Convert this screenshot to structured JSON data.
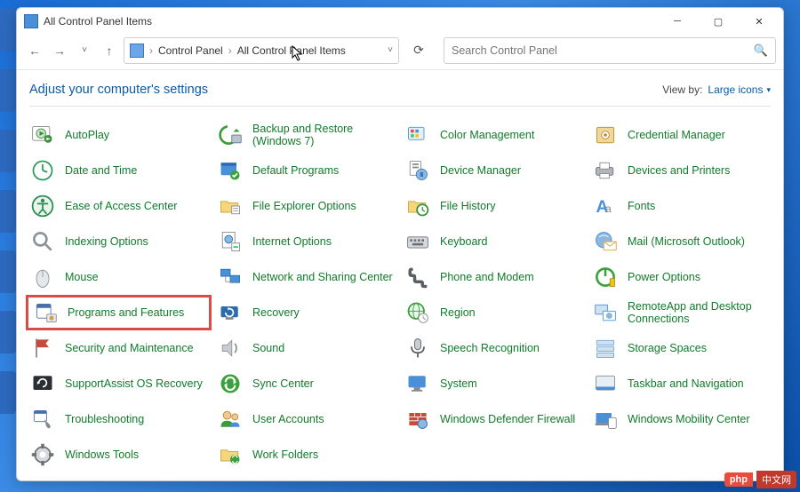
{
  "titlebar": {
    "title": "All Control Panel Items"
  },
  "nav": {
    "breadcrumb1": "Control Panel",
    "breadcrumb2": "All Control Panel Items",
    "search_placeholder": "Search Control Panel"
  },
  "header": {
    "text": "Adjust your computer's settings",
    "viewby_label": "View by:",
    "viewby_value": "Large icons"
  },
  "items": {
    "r0c0": "AutoPlay",
    "r0c1": "Backup and Restore (Windows 7)",
    "r0c2": "Color Management",
    "r0c3": "Credential Manager",
    "r1c0": "Date and Time",
    "r1c1": "Default Programs",
    "r1c2": "Device Manager",
    "r1c3": "Devices and Printers",
    "r2c0": "Ease of Access Center",
    "r2c1": "File Explorer Options",
    "r2c2": "File History",
    "r2c3": "Fonts",
    "r3c0": "Indexing Options",
    "r3c1": "Internet Options",
    "r3c2": "Keyboard",
    "r3c3": "Mail (Microsoft Outlook)",
    "r4c0": "Mouse",
    "r4c1": "Network and Sharing Center",
    "r4c2": "Phone and Modem",
    "r4c3": "Power Options",
    "r5c0": "Programs and Features",
    "r5c1": "Recovery",
    "r5c2": "Region",
    "r5c3": "RemoteApp and Desktop Connections",
    "r6c0": "Security and Maintenance",
    "r6c1": "Sound",
    "r6c2": "Speech Recognition",
    "r6c3": "Storage Spaces",
    "r7c0": "SupportAssist OS Recovery",
    "r7c1": "Sync Center",
    "r7c2": "System",
    "r7c3": "Taskbar and Navigation",
    "r8c0": "Troubleshooting",
    "r8c1": "User Accounts",
    "r8c2": "Windows Defender Firewall",
    "r8c3": "Windows Mobility Center",
    "r9c0": "Windows Tools",
    "r9c1": "Work Folders"
  },
  "watermark": {
    "brand": "php",
    "text": "中文网"
  },
  "icon_colors": {
    "autoplay": "#3b8f3b",
    "backup": "#3b9b3b",
    "color": "#4a90d9",
    "credential": "#d99a2b",
    "date": "#2b9b5a",
    "default": "#2b6cb0",
    "device": "#3a7bbf",
    "printers": "#6a6f76",
    "ease": "#2d8a4e",
    "fileexp": "#e0a93a",
    "filehist": "#e0a93a",
    "fonts": "#4a90d9",
    "indexing": "#8a9199",
    "internet": "#2b6cb0",
    "keyboard": "#6b7075",
    "mail": "#4a90d9",
    "mouse": "#8a9199",
    "network": "#4a90d9",
    "phone": "#5a5f64",
    "power": "#3aa23a",
    "programs": "#4a6fae",
    "recovery": "#2b6cb0",
    "region": "#3b9b3b",
    "remote": "#4a90d9",
    "security": "#c84a3a",
    "sound": "#8a9199",
    "speech": "#5a5f64",
    "storage": "#7aa7cf",
    "support": "#2b2f33",
    "sync": "#3aa23a",
    "system": "#4a90d9",
    "taskbar": "#4a90d9",
    "trouble": "#4a6fae",
    "user": "#3b9b3b",
    "firewall": "#c84a3a",
    "mobility": "#4a90d9",
    "tools": "#6b7075",
    "folders": "#e0a93a"
  }
}
